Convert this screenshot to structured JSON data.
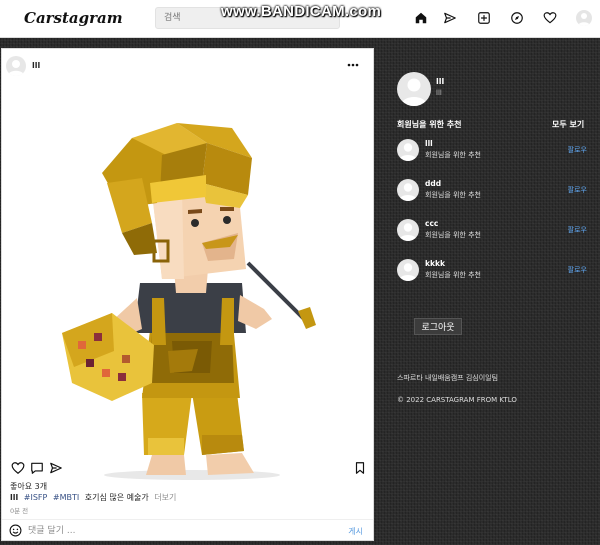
{
  "nav": {
    "logo": "Carstagram",
    "search_placeholder": "검색",
    "watermark": "www.BANDICAM.com",
    "icons": [
      "home-icon",
      "send-icon",
      "add-post-icon",
      "explore-icon",
      "heart-icon",
      "profile-avatar"
    ]
  },
  "post": {
    "username": "lll",
    "likes": "좋아요 3개",
    "caption_user": "lll",
    "hashtags": [
      "#ISFP",
      "#MBTI"
    ],
    "caption_text": "호기심 많은 예술가",
    "more_label": "더보기",
    "time_ago": "0분 전",
    "comment_placeholder": "댓글 달기 ...",
    "post_label": "게시"
  },
  "sidebar": {
    "profile_name": "lll",
    "profile_sub": "lll",
    "rec_title": "회원님을 위한 추천",
    "see_all": "모두 보기",
    "recommendations": [
      {
        "name": "lll",
        "subtitle": "회원님을 위한 추천",
        "action": "팔로우"
      },
      {
        "name": "ddd",
        "subtitle": "회원님을 위한 추천",
        "action": "팔로우"
      },
      {
        "name": "ccc",
        "subtitle": "회원님을 위한 추천",
        "action": "팔로우"
      },
      {
        "name": "kkkk",
        "subtitle": "회원님을 위한 추천",
        "action": "팔로우"
      }
    ],
    "logout_label": "로그아웃",
    "footer_line1": "스파르타 내일배움캠프 김심이일팀",
    "footer_line2": "© 2022 CARSTAGRAM FROM KTLO"
  },
  "colors": {
    "link_blue": "#385185",
    "follow_blue": "#5fa6f0",
    "background": "#2b2b2b"
  }
}
